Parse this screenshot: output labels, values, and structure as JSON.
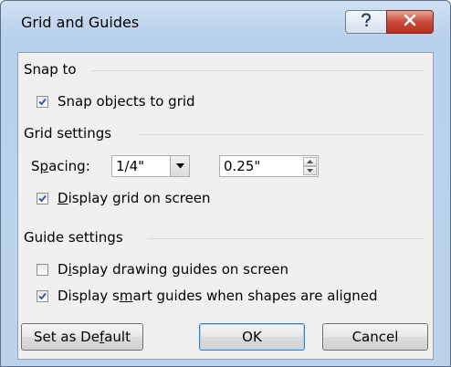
{
  "window": {
    "title": "Grid and Guides"
  },
  "titlebar": {
    "help_icon": "question-mark-icon",
    "close_icon": "close-x-icon"
  },
  "snap_to": {
    "header": "Snap to",
    "snap_objects": {
      "pre": "Snap objects to ",
      "accel": "g",
      "post": "rid",
      "checked": true
    }
  },
  "grid_settings": {
    "header": "Grid settings",
    "spacing_label": {
      "pre": "S",
      "accel": "p",
      "post": "acing:"
    },
    "spacing_combo_value": "1/4\"",
    "spacing_spin_value": "0.25\"",
    "display_grid": {
      "pre": "",
      "accel": "D",
      "post": "isplay grid on screen",
      "checked": true
    }
  },
  "guide_settings": {
    "header": "Guide settings",
    "display_drawing_guides": {
      "pre": "D",
      "accel": "i",
      "post": "splay drawing guides on screen",
      "checked": false
    },
    "display_smart_guides": {
      "pre": "Display s",
      "accel": "m",
      "post": "art guides when shapes are aligned",
      "checked": true
    }
  },
  "buttons": {
    "set_default": {
      "pre": "Set as De",
      "accel": "f",
      "post": "ault"
    },
    "ok": "OK",
    "cancel": "Cancel"
  }
}
